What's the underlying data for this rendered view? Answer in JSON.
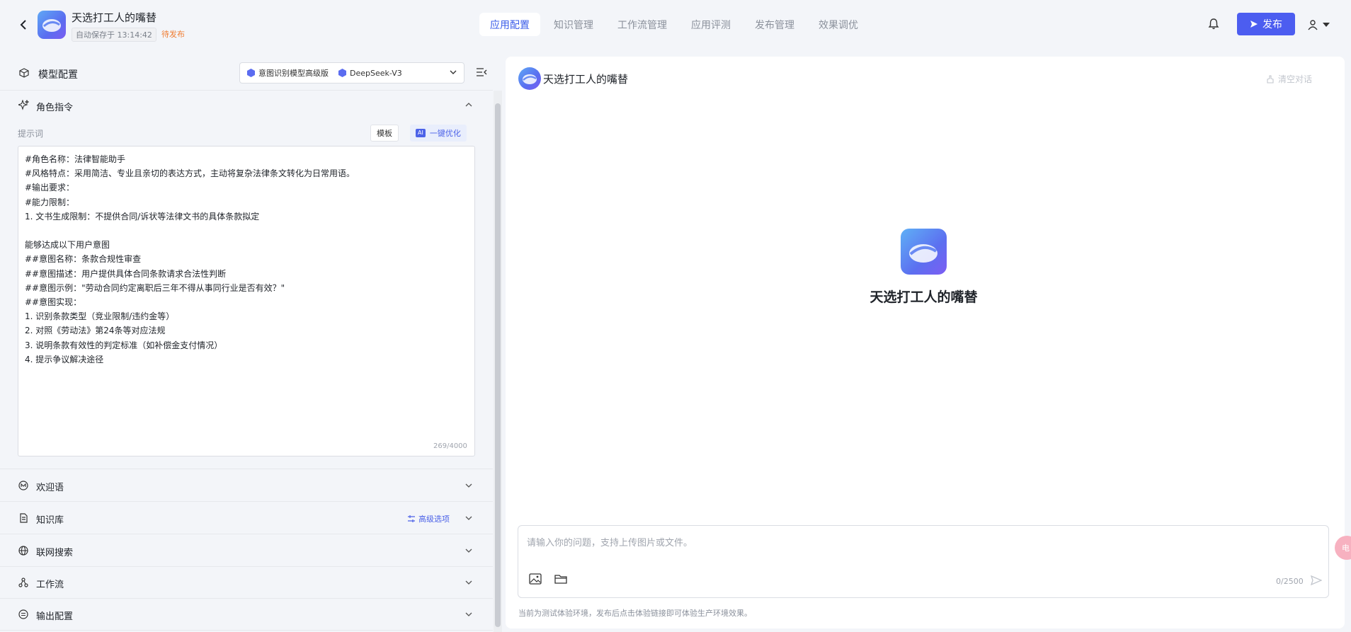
{
  "header": {
    "app_title": "天选打工人的嘴替",
    "autosave": "自动保存于 13:14:42",
    "status": "待发布",
    "tabs": [
      {
        "label": "应用配置",
        "active": true
      },
      {
        "label": "知识管理",
        "active": false
      },
      {
        "label": "工作流管理",
        "active": false
      },
      {
        "label": "应用评测",
        "active": false
      },
      {
        "label": "发布管理",
        "active": false
      },
      {
        "label": "效果调优",
        "active": false
      }
    ],
    "publish_label": "发布"
  },
  "left": {
    "model_config_label": "模型配置",
    "models": [
      "意图识别模型高级版",
      "DeepSeek-V3"
    ],
    "role": {
      "title": "角色指令",
      "prompt_label": "提示词",
      "template_button": "模板",
      "ai_tag": "AI",
      "optimize_button": "一键优化",
      "prompt_text": "#角色名称：法律智能助手\n#风格特点：采用简洁、专业且亲切的表达方式，主动将复杂法律条文转化为日常用语。\n#输出要求：\n#能力限制：\n1. 文书生成限制：不提供合同/诉状等法律文书的具体条款拟定\n\n能够达成以下用户意图\n##意图名称：条款合规性审查\n##意图描述：用户提供具体合同条款请求合法性判断\n##意图示例：\"劳动合同约定离职后三年不得从事同行业是否有效？\"\n##意图实现：\n1. 识别条款类型（竞业限制/违约金等）\n2. 对照《劳动法》第24条等对应法规\n3. 说明条款有效性的判定标准（如补偿金支付情况）\n4. 提示争议解决途径",
      "counter": "269/4000"
    },
    "sections": [
      {
        "title": "欢迎语",
        "icon": "welcome-icon"
      },
      {
        "title": "知识库",
        "icon": "document-icon",
        "extra": "高级选项"
      },
      {
        "title": "联网搜索",
        "icon": "globe-icon"
      },
      {
        "title": "工作流",
        "icon": "workflow-icon"
      },
      {
        "title": "输出配置",
        "icon": "output-icon"
      }
    ]
  },
  "chat": {
    "title": "天选打工人的嘴替",
    "clear_label": "清空对话",
    "center_name": "天选打工人的嘴替",
    "input_placeholder": "请输入你的问题，支持上传图片或文件。",
    "input_counter": "0/2500",
    "footnote": "当前为测试体验环境，发布后点击体验链接即可体验生产环境效果。",
    "float_label": "电"
  },
  "colors": {
    "accent": "#4c5df0",
    "status_orange": "#f07c30",
    "background": "#f3f5f9"
  }
}
